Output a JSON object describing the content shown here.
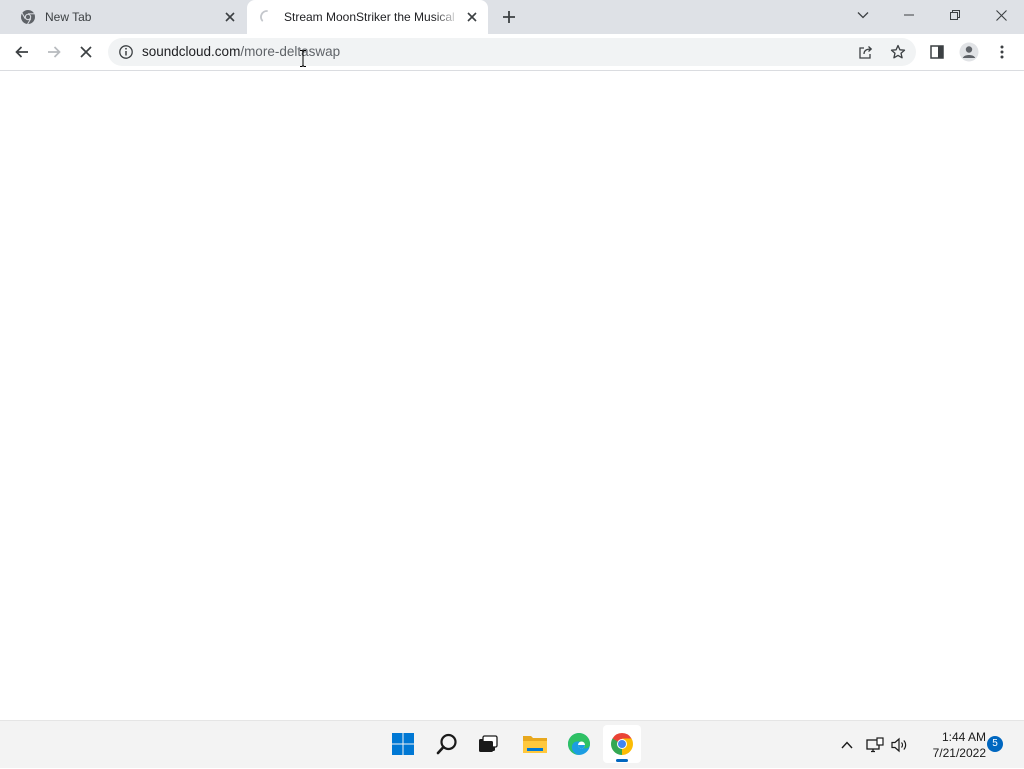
{
  "browser": {
    "tabs": [
      {
        "title": "New Tab",
        "icon": "chrome-icon",
        "active": false
      },
      {
        "title": "Stream MoonStriker the Musical",
        "icon": "loading-spinner-icon",
        "active": true
      }
    ],
    "omnibox": {
      "url_host": "soundcloud.com",
      "url_path": "/more-deltaswap"
    }
  },
  "taskbar": {
    "apps": [
      {
        "name": "start",
        "icon": "windows-start-icon"
      },
      {
        "name": "search",
        "icon": "search-icon"
      },
      {
        "name": "task-view",
        "icon": "task-view-icon"
      },
      {
        "name": "file-explorer",
        "icon": "folder-icon"
      },
      {
        "name": "edge",
        "icon": "edge-icon"
      },
      {
        "name": "chrome",
        "icon": "chrome-icon",
        "active": true
      }
    ],
    "clock": {
      "time": "1:44 AM",
      "date": "7/21/2022"
    },
    "notification_count": "5"
  },
  "colors": {
    "tabstrip_bg": "#dee1e6",
    "omnibox_bg": "#f1f3f4",
    "taskbar_bg": "#f3f3f3",
    "accent": "#0067c0"
  }
}
